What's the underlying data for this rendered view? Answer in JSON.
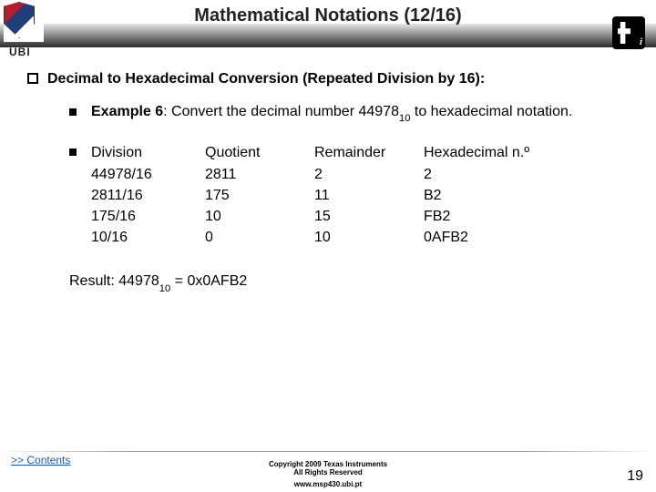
{
  "header": {
    "title": "Mathematical Notations (12/16)",
    "left_label": "UBI"
  },
  "body": {
    "section_heading": "Decimal to Hexadecimal Conversion (Repeated Division by 16):",
    "example": {
      "label": "Example 6",
      "text_prefix": "Convert the decimal number",
      "number": "44978",
      "base": "10",
      "text_suffix": "to hexadecimal notation."
    },
    "table": {
      "headers": [
        "Division",
        "Quotient",
        "Remainder",
        "Hexadecimal n.º"
      ],
      "rows": [
        [
          "44978/16",
          "2811",
          "2",
          "2"
        ],
        [
          "2811/16",
          "175",
          "11",
          "B2"
        ],
        [
          "175/16",
          "10",
          "15",
          "FB2"
        ],
        [
          "10/16",
          "0",
          "10",
          "0AFB2"
        ]
      ]
    },
    "result": {
      "label": "Result: ",
      "number": "44978",
      "base": "10",
      "equals": " = ",
      "hex": "0x0AFB2"
    }
  },
  "footer": {
    "contents_link": ">> Contents",
    "copyright_line1": "Copyright 2009 Texas Instruments",
    "copyright_line2": "All Rights Reserved",
    "url": "www.msp430.ubi.pt",
    "page_number": "19"
  }
}
